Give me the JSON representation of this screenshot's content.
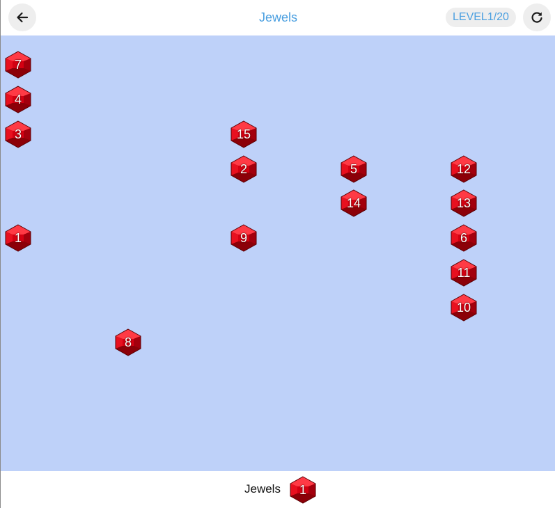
{
  "header": {
    "title": "Jewels",
    "level": "LEVEL1/20",
    "back_icon": "arrow-left-icon",
    "restart_icon": "refresh-icon"
  },
  "board": {
    "background": "#bed1f9",
    "gem_color": "#d40012",
    "jewels": [
      {
        "number": "7"
      },
      {
        "number": "4"
      },
      {
        "number": "3"
      },
      {
        "number": "1"
      },
      {
        "number": "15"
      },
      {
        "number": "2"
      },
      {
        "number": "9"
      },
      {
        "number": "8"
      },
      {
        "number": "5"
      },
      {
        "number": "14"
      },
      {
        "number": "12"
      },
      {
        "number": "13"
      },
      {
        "number": "6"
      },
      {
        "number": "11"
      },
      {
        "number": "10"
      }
    ]
  },
  "footer": {
    "label": "Jewels",
    "next_jewel": "1"
  }
}
